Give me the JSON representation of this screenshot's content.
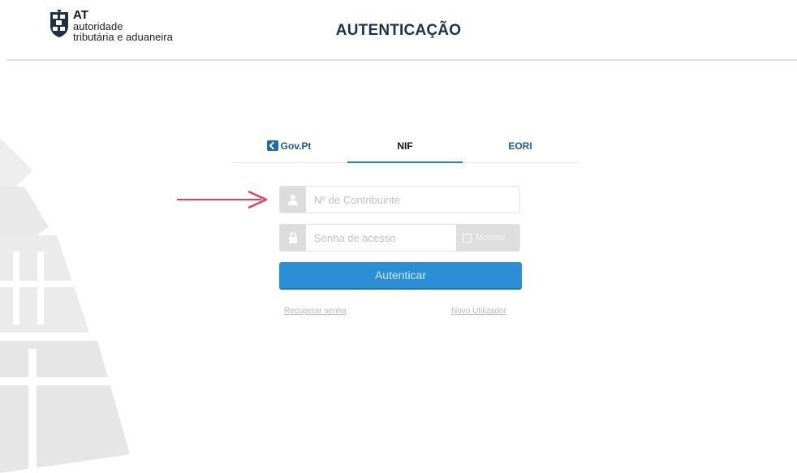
{
  "header": {
    "logo": {
      "line1": "AT",
      "line2": "autoridade",
      "line3": "tributária e aduaneira"
    },
    "title": "AUTENTICAÇÃO"
  },
  "tabs": [
    {
      "label": "Gov.Pt",
      "icon": "govpt-logo-icon",
      "active": false
    },
    {
      "label": "NIF",
      "active": true
    },
    {
      "label": "EORI",
      "active": false
    }
  ],
  "form": {
    "username": {
      "placeholder": "Nº de Contribuinte",
      "value": "",
      "icon": "user-icon"
    },
    "password": {
      "placeholder": "Senha de acesso",
      "value": "",
      "icon": "lock-icon"
    },
    "show_password": {
      "label": "Mostrar",
      "checked": false
    },
    "submit_label": "Autenticar"
  },
  "links": {
    "recover": "Recuperar senha",
    "new_user": "Novo Utilizador"
  },
  "colors": {
    "accent": "#2a8fd6",
    "title": "#1a3150",
    "annotation_arrow": "#e0415f"
  }
}
